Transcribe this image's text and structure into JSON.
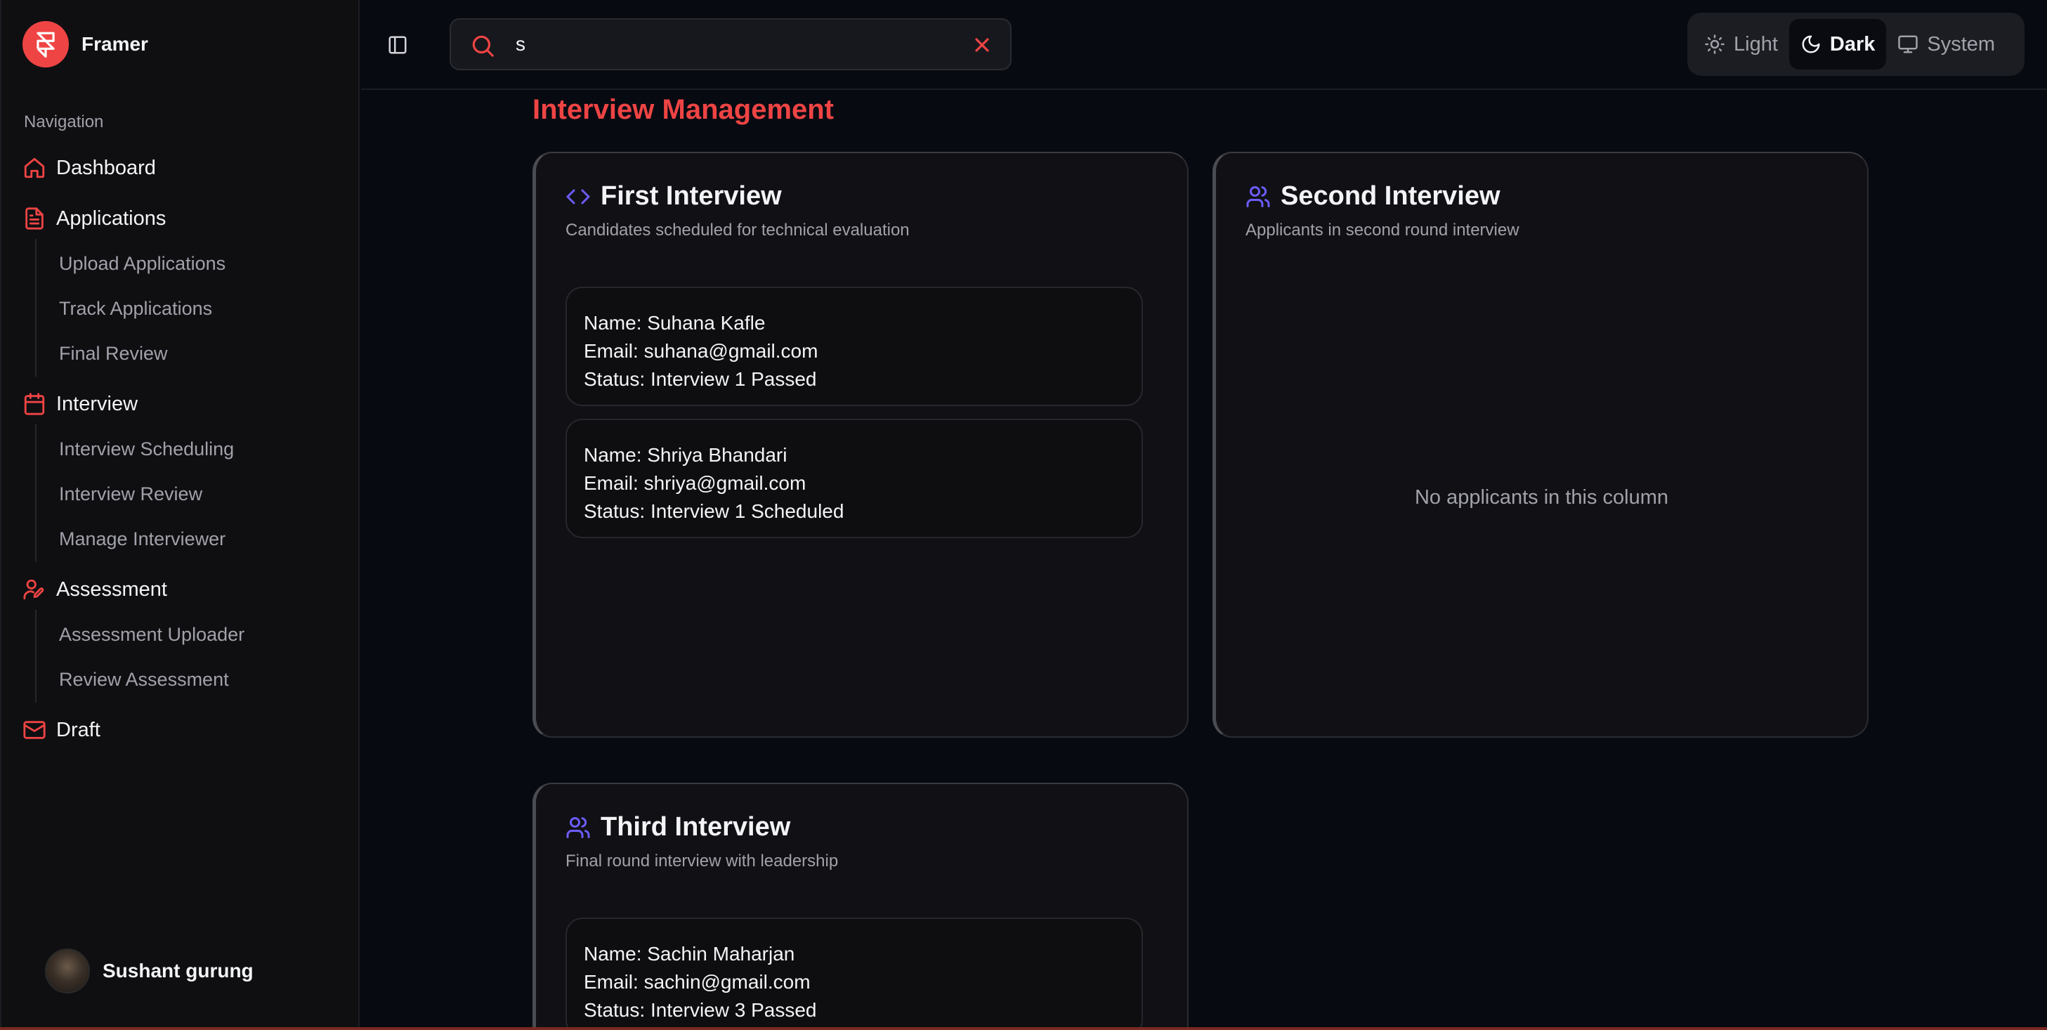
{
  "brand": {
    "name": "Framer"
  },
  "nav": {
    "heading": "Navigation",
    "items": [
      {
        "label": "Dashboard",
        "icon": "home-icon"
      },
      {
        "label": "Applications",
        "icon": "file-text-icon",
        "children": [
          "Upload Applications",
          "Track Applications",
          "Final Review"
        ]
      },
      {
        "label": "Interview",
        "icon": "calendar-icon",
        "children": [
          "Interview Scheduling",
          "Interview Review",
          "Manage Interviewer"
        ]
      },
      {
        "label": "Assessment",
        "icon": "user-pen-icon",
        "children": [
          "Assessment Uploader",
          "Review Assessment"
        ]
      },
      {
        "label": "Draft",
        "icon": "mail-icon"
      }
    ]
  },
  "user": {
    "name": "Sushant gurung"
  },
  "search": {
    "value": "s"
  },
  "theme": {
    "options": [
      "Light",
      "Dark",
      "System"
    ],
    "selected": "Dark"
  },
  "page": {
    "title": "Interview Management"
  },
  "columns": [
    {
      "title": "First Interview",
      "subtitle": "Candidates scheduled for technical evaluation",
      "icon": "code-icon",
      "cards": [
        {
          "name": "Name: Suhana Kafle",
          "email": "Email: suhana@gmail.com",
          "status": "Status: Interview 1 Passed"
        },
        {
          "name": "Name: Shriya Bhandari",
          "email": "Email: shriya@gmail.com",
          "status": "Status: Interview 1 Scheduled"
        }
      ]
    },
    {
      "title": "Second Interview",
      "subtitle": "Applicants in second round interview",
      "icon": "users-icon",
      "empty": "No applicants in this column",
      "cards": []
    },
    {
      "title": "Third Interview",
      "subtitle": "Final round interview with leadership",
      "icon": "users-icon",
      "cards": [
        {
          "name": "Name: Sachin Maharjan",
          "email": "Email: sachin@gmail.com",
          "status": "Status: Interview 3 Passed"
        }
      ]
    }
  ],
  "colors": {
    "accent": "#ef4444",
    "icon_purple": "#6d5dfc",
    "background": "#080a12",
    "panel": "#111115"
  }
}
